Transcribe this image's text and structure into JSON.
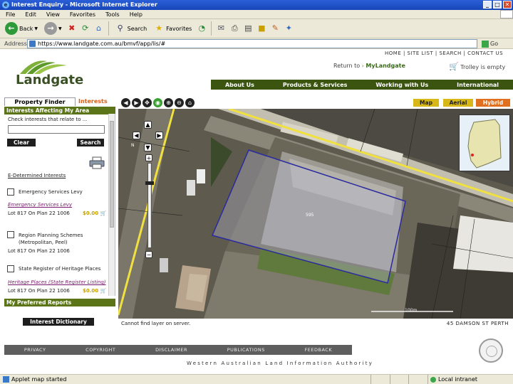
{
  "window": {
    "title": "Interest Enquiry - Microsoft Internet Explorer",
    "btn_min": "_",
    "btn_max": "□",
    "btn_close": "✕"
  },
  "menubar": {
    "items": [
      "File",
      "Edit",
      "View",
      "Favorites",
      "Tools",
      "Help"
    ]
  },
  "toolbar": {
    "back": "Back",
    "search": "Search",
    "favorites": "Favorites"
  },
  "address": {
    "label": "Address",
    "url": "https://www.landgate.com.au/bmvf/app/lis/#",
    "go": "Go"
  },
  "site": {
    "topnav": "HOME  |  SITE LIST  |  SEARCH  |  CONTACT US",
    "logo_text": "Landgate",
    "return_prefix": "Return to",
    "return_link": "MyLandgate",
    "trolley": "Trolley is empty",
    "mainnav": [
      "About Us",
      "Products & Services",
      "Working with Us",
      "International"
    ]
  },
  "left": {
    "tab_property_finder": "Property Finder",
    "tab_interests": "Interests",
    "section_interests": "Interests Affecting My Area",
    "check_prompt": "Check interests that relate to ...",
    "clear": "Clear",
    "search": "Search",
    "determined": "E-Determined Interests",
    "items": [
      {
        "label": "Emergency Services Levy",
        "link": "Emergency Services Levy",
        "lot": "Lot 817 On Plan 22 1006",
        "price": "$0.00"
      },
      {
        "label": "Region Planning Schemes (Metropolitan, Peel)",
        "lot": "Lot 817 On Plan 22 1006"
      },
      {
        "label": "State Register of Heritage Places",
        "link": "Heritage Places (State Register Listing)",
        "lot": "Lot 817 On Plan 22 1006",
        "price": "$0.00"
      }
    ],
    "section_reports": "My Preferred Reports",
    "dictionary": "Interest Dictionary"
  },
  "map": {
    "tools": [
      "◀",
      "▶",
      "✥",
      "◉",
      "⊕",
      "⊖",
      "⌂"
    ],
    "types": [
      "Map",
      "Aerial",
      "Hybrid"
    ],
    "status_left": "Cannot find layer on server.",
    "status_right": "45 DAMSON ST  PERTH",
    "parcel_label": "595",
    "north": "N",
    "scale": "100m"
  },
  "footer": {
    "links": [
      "PRIVACY",
      "COPYRIGHT",
      "DISCLAIMER",
      "PUBLICATIONS",
      "FEEDBACK"
    ],
    "agency": "Western Australian Land Information Authority"
  },
  "status": {
    "left": "Applet map started",
    "right": "Local intranet"
  },
  "colors": {
    "nav_green": "#3b5510",
    "section_green": "#5b7418",
    "hybrid_orange": "#e07020",
    "tab_yellow": "#d8b818"
  }
}
